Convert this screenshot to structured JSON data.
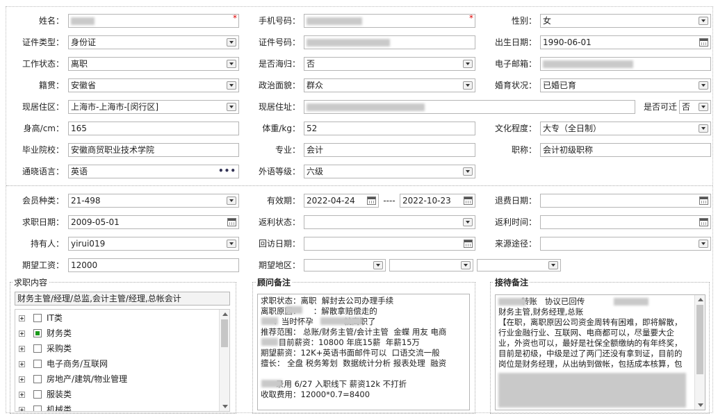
{
  "personal": {
    "name": {
      "label": "姓名：",
      "value": ""
    },
    "phone": {
      "label": "手机号码：",
      "value": ""
    },
    "gender": {
      "label": "性别：",
      "value": "女"
    },
    "id_type": {
      "label": "证件类型：",
      "value": "身份证"
    },
    "id_number": {
      "label": "证件号码：",
      "value": ""
    },
    "birth_date": {
      "label": "出生日期：",
      "value": "1990-06-01"
    },
    "work_status": {
      "label": "工作状态：",
      "value": "离职"
    },
    "returnee": {
      "label": "是否海归：",
      "value": "否"
    },
    "email": {
      "label": "电子邮箱：",
      "value": ""
    },
    "native_place": {
      "label": "籍贯：",
      "value": "安徽省"
    },
    "political": {
      "label": "政治面貌：",
      "value": "群众"
    },
    "marital": {
      "label": "婚育状况：",
      "value": "已婚已育"
    },
    "residence_area": {
      "label": "现居住区：",
      "value": "上海市-上海市-[闵行区]"
    },
    "address": {
      "label": "现居住址：",
      "value": ""
    },
    "transfer": {
      "label": "是否可迁",
      "value": "否"
    },
    "height": {
      "label": "身高/cm：",
      "value": "165"
    },
    "weight": {
      "label": "体重/kg：",
      "value": "52"
    },
    "education": {
      "label": "文化程度：",
      "value": "大专（全日制）"
    },
    "school": {
      "label": "毕业院校：",
      "value": "安徽商贸职业技术学院"
    },
    "major": {
      "label": "专业：",
      "value": "会计"
    },
    "title": {
      "label": "职称：",
      "value": "会计初级职称"
    },
    "language": {
      "label": "通晓语言：",
      "value": "英语"
    },
    "foreign_level": {
      "label": "外语等级：",
      "value": "六级"
    }
  },
  "membership": {
    "member_type": {
      "label": "会员种类：",
      "value": "21-498"
    },
    "validity": {
      "label": "有效期：",
      "from": "2022-04-24",
      "sep": "----",
      "to": "2022-10-23"
    },
    "refund_date": {
      "label": "退费日期：",
      "value": ""
    },
    "job_date": {
      "label": "求职日期：",
      "value": "2009-05-01"
    },
    "rebate_status": {
      "label": "返利状态：",
      "value": ""
    },
    "rebate_time": {
      "label": "返利时间：",
      "value": ""
    },
    "holder": {
      "label": "持有人：",
      "value": "yirui019"
    },
    "visit_date": {
      "label": "回访日期：",
      "value": ""
    },
    "source": {
      "label": "来源途径：",
      "value": ""
    },
    "expected_salary": {
      "label": "期望工资：",
      "value": "12000"
    },
    "expected_region": {
      "label": "期望地区：",
      "value": ""
    }
  },
  "job_panel": {
    "title": "求职内容",
    "summary": "财务主管/经理/总监,会计主管/经理,总帐会计",
    "items": [
      {
        "label": "IT类",
        "checked": false
      },
      {
        "label": "财务类",
        "checked": true
      },
      {
        "label": "采购类",
        "checked": false
      },
      {
        "label": "电子商务/互联网",
        "checked": false
      },
      {
        "label": "房地产/建筑/物业管理",
        "checked": false
      },
      {
        "label": "服装类",
        "checked": false
      },
      {
        "label": "机械类",
        "checked": false
      }
    ]
  },
  "advisor_panel": {
    "title": "顾问备注",
    "text": "求职状态：离职  解封去公司办理手续\n离职原因：     ：解散拿赔偿走的\n     ：当时怀孕            就离职了\n推荐范围： 总账/财务主管/会计主管  金蝶 用友 电商\n       目前薪资：10800 年底15薪  年薪15万\n期望薪资：12K+英语书面邮件可以  口语交流一般\n擅长： 全盘 税务筹划  数据统计分析 报表处理  融资\n\n      录用 6/27 入职线下 薪资12k 不打折\n收取费用：12000*0.7=8400"
  },
  "reception_panel": {
    "title": "接待备注",
    "text": "         转账   协议已回传\n财务主管,财务经理,总账\n【在职，离职原因公司资金周转有困难，即将解散，\n行业金融行业、互联网、电商都可以，尽量要大企\n业，外资也可以，最好是社保全额缴纳的有年终奖，\n目前是初级，中级是过了两门还没有拿到证，目前的\n岗位是财务经理，从出纳到做帐，包括成本核算，包"
  }
}
